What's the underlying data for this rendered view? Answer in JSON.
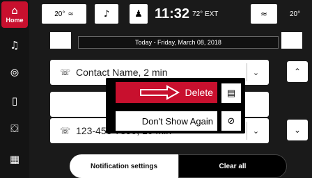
{
  "sidebar": {
    "items": [
      {
        "name": "home",
        "label": "Home",
        "icon": "home-icon",
        "active": true
      },
      {
        "name": "music",
        "icon": "music-icon"
      },
      {
        "name": "nav",
        "icon": "compass-icon"
      },
      {
        "name": "phone",
        "icon": "phone-icon"
      },
      {
        "name": "car",
        "icon": "car-icon"
      },
      {
        "name": "apps",
        "icon": "apps-grid-icon"
      }
    ]
  },
  "topbar": {
    "left_temp": "20°",
    "clock": "11:32",
    "ext_temp": "72° EXT",
    "right_temp": "20°"
  },
  "date_bar": "Today - Friday, March 08, 2018",
  "notifications": [
    {
      "text": "Contact Name, 2 min"
    },
    {
      "text": "123-456-7890, 10 min"
    }
  ],
  "popup": {
    "delete_label": "Delete",
    "dont_show_label": "Don't Show Again"
  },
  "bottom": {
    "notification_settings": "Notification settings",
    "clear_all": "Clear all"
  },
  "colors": {
    "accent": "#c8102e",
    "background": "#1a1a1a"
  }
}
